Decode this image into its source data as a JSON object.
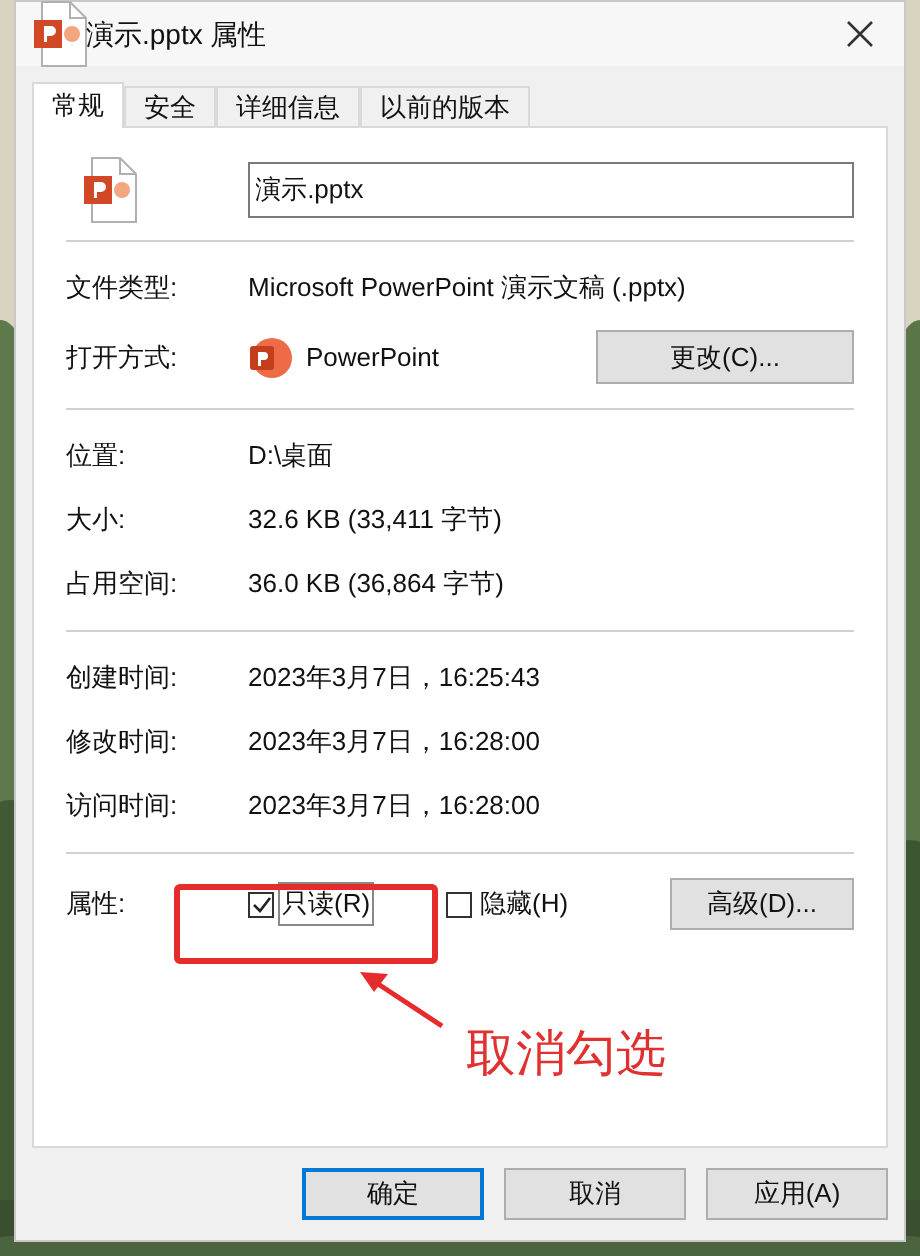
{
  "window": {
    "title": "演示.pptx 属性"
  },
  "tabs": [
    {
      "label": "常规",
      "selected": true
    },
    {
      "label": "安全",
      "selected": false
    },
    {
      "label": "详细信息",
      "selected": false
    },
    {
      "label": "以前的版本",
      "selected": false
    }
  ],
  "file_name": {
    "value": "演示.pptx"
  },
  "sections": [
    [
      {
        "kind": "text",
        "label": "文件类型:",
        "value": "Microsoft PowerPoint 演示文稿 (.pptx)"
      },
      {
        "kind": "app",
        "label": "打开方式:",
        "value": "PowerPoint",
        "button": "更改(C)..."
      }
    ],
    [
      {
        "kind": "text",
        "label": "位置:",
        "value": "D:\\桌面"
      },
      {
        "kind": "text",
        "label": "大小:",
        "value": "32.6 KB (33,411 字节)"
      },
      {
        "kind": "text",
        "label": "占用空间:",
        "value": "36.0 KB (36,864 字节)"
      }
    ],
    [
      {
        "kind": "text",
        "label": "创建时间:",
        "value": "2023年3月7日，16:25:43"
      },
      {
        "kind": "text",
        "label": "修改时间:",
        "value": "2023年3月7日，16:28:00"
      },
      {
        "kind": "text",
        "label": "访问时间:",
        "value": "2023年3月7日，16:28:00"
      }
    ]
  ],
  "attributes": {
    "label": "属性:",
    "options": [
      {
        "label": "只读(R)",
        "checked": true,
        "focused": true
      },
      {
        "label": "隐藏(H)",
        "checked": false,
        "focused": false
      }
    ],
    "button": "高级(D)..."
  },
  "annotation": {
    "text": "取消勾选"
  },
  "buttons": [
    {
      "label": "确定",
      "default": true
    },
    {
      "label": "取消",
      "default": false
    },
    {
      "label": "应用(A)",
      "default": false
    }
  ]
}
